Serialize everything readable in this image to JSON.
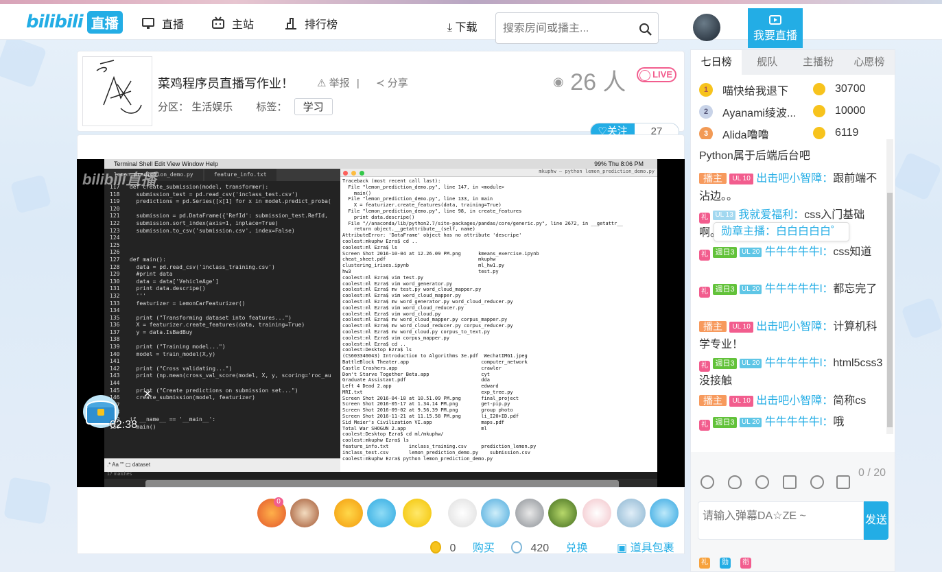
{
  "header": {
    "logo_text": "bilibili",
    "logo_live": "直播",
    "nav": [
      {
        "label": "直播",
        "icon": "monitor-icon"
      },
      {
        "label": "主站",
        "icon": "tv-icon"
      },
      {
        "label": "排行榜",
        "icon": "chart-icon"
      }
    ],
    "download": "下载",
    "search_placeholder": "搜索房间或播主...",
    "go_live": "我要直播"
  },
  "room": {
    "title": "菜鸡程序员直播写作业！",
    "report": "举报",
    "share": "分享",
    "area_label": "分区：",
    "area": "生活娱乐",
    "tag_label": "标签：",
    "tag": "学习",
    "viewers": "26 人",
    "live_badge": "LIVE",
    "follow_label": "关注",
    "follow_count": "27"
  },
  "player": {
    "timer": "02:38",
    "mac_menu": "Terminal   Shell   Edit   View   Window   Help",
    "mac_status": "99%   Thu 8:06 PM",
    "tab1": "lemon_prediction_demo.py",
    "tab2": "feature_info.txt",
    "find_text": "dataset",
    "matches": "17 matches",
    "term_title": "mkuphw — python lemon_prediction_demo.py",
    "code_lines": [
      "117   def create_submission(model, transformer):",
      "118     submission_test = pd.read_csv('inclass_test.csv')",
      "119     predictions = pd.Series([x[1] for x in model.predict_proba(",
      "120",
      "121     submission = pd.DataFrame({'RefId': submission_test.RefId,",
      "122     submission.sort_index(axis=1, inplace=True)",
      "123     submission.to_csv('submission.csv', index=False)",
      "124",
      "125",
      "126",
      "127   def main():",
      "128     data = pd.read_csv('inclass_training.csv')",
      "129     #print data",
      "130     data = data['VehicleAge']",
      "131     print data.descripe()",
      "132     '''",
      "133     featurizer = LemonCarFeaturizer()",
      "134",
      "135     print (\"Transforming dataset into features...\")",
      "136     X = featurizer.create_features(data, training=True)",
      "137     y = data.IsBadBuy",
      "138",
      "139     print (\"Training model...\")",
      "140     model = train_model(X,y)",
      "141",
      "142     print (\"Cross validating...\")",
      "143     print (np.mean(cross_val_score(model, X, y, scoring='roc_au",
      "144",
      "145     print (\"Create predictions on submission set...\")",
      "146     create_submission(model, featurizer)",
      "147",
      "148",
      "149   if __name__ == '__main__':",
      "150     main()"
    ],
    "term_lines": [
      "Traceback (most recent call last):",
      "  File \"lemon_prediction_demo.py\", line 147, in <module>",
      "    main()",
      "  File \"lemon_prediction_demo.py\", line 133, in main",
      "    X = featurizer.create_features(data, training=True)",
      "  File \"lemon_prediction_demo.py\", line 98, in create_features",
      "    print data.descripe()",
      "  File \"//anaconda/lib/python2.7/site-packages/pandas/core/generic.py\", line 2672, in __getattr__",
      "    return object.__getattribute__(self, name)",
      "AttributeError: 'DataFrame' object has no attribute 'descripe'",
      "coolest:mkuphw Ezra$ cd ..",
      "coolest:ml Ezra$ ls",
      "Screen Shot 2016-10-04 at 12.26.09 PM.png      kmeans_exercise.ipynb",
      "cheat_sheet.pdf                                mkuphw",
      "clustering_irises.ipynb                        ml_hw1.py",
      "hw3                                            test.py",
      "coolest:ml Ezra$ vim test.py",
      "coolest:ml Ezra$ vim word_generator.py",
      "coolest:ml Ezra$ mv test.py word_cloud_mapper.py",
      "coolest:ml Ezra$ vim word_cloud_mapper.py",
      "coolest:ml Ezra$ mv word_generator.py word_cloud_reducer.py",
      "coolest:ml Ezra$ vim word_cloud_reducer.py",
      "coolest:ml Ezra$ vim word_cloud.py",
      "coolest:ml Ezra$ mv word_cloud_mapper.py corpus_mapper.py",
      "coolest:ml Ezra$ mv word_cloud_reducer.py corpus_reducer.py",
      "coolest:ml Ezra$ mv word_cloud.py corpus_to_text.py",
      "coolest:ml Ezra$ vim corpus_mapper.py",
      "coolest:ml Ezra$ cd ..",
      "coolest:Desktop Ezra$ ls",
      "(CS603346043) Introduction to Algorithms 3e.pdf  WechatIMG1.jpeg",
      "BattleBlock Theater.app                         computer_network",
      "Castle Crashers.app                             crawler",
      "Don't Starve Together Beta.app                  cyt",
      "Graduate Assistant.pdf                          dda",
      "Left 4 Dead 2.app                               edward",
      "MRI.txt                                         exp_tree.py",
      "Screen Shot 2016-04-18 at 10.51.09 PM.png       final_project",
      "Screen Shot 2016-05-17 at 1.34.14 PM.png        get-pip.py",
      "Screen Shot 2016-09-02 at 9.56.39 PM.png        group photo",
      "Screen Shot 2016-11-21 at 11.15.58 PM.png       li_I20+ID.pdf",
      "Sid Meier's Civilization VI.app                 maps.pdf",
      "Total War SHOGUN 2.app                          ml",
      "coolest:Desktop Ezra$ cd ml/mkuphw/",
      "coolest:mkuphw Ezra$ ls",
      "feature_info.txt       inclass_training.csv     prediction_lemon.py",
      "inclass_test.csv       lemon_prediction_demo.py    submission.csv",
      "coolest:mkuphw Ezra$ python lemon_prediction_demo.py"
    ],
    "watermark": "bilibili直播"
  },
  "gifts": {
    "badge_count": "0",
    "gold_count": "0",
    "buy_label": "购买",
    "silver_count": "420",
    "exchange_label": "兑换",
    "bag_label": "道具包裹"
  },
  "sidebar": {
    "tabs": [
      "七日榜",
      "舰队",
      "主播粉",
      "心愿榜"
    ],
    "ranking": [
      {
        "rank": "1",
        "name": "喵快给我退下",
        "score": "30700"
      },
      {
        "rank": "2",
        "name": "Ayanami绫波...",
        "score": "10000"
      },
      {
        "rank": "3",
        "name": "Alida噜噜",
        "score": "6119"
      }
    ],
    "chat": [
      {
        "type": "cont",
        "text": "Python属于后端后台吧"
      },
      {
        "type": "host",
        "host": "播主",
        "lvl": "UL 10",
        "user": "出击吧小智障：",
        "text": "跟前端不沾边。。"
      },
      {
        "type": "user",
        "lvl": "UL 13",
        "user": "我就爱福利：",
        "text": "css入门基础啊。"
      },
      {
        "type": "fan",
        "medal": "週日3",
        "lvl": "UL 20",
        "user": "牛牛牛牛牛l：",
        "text": "css知道"
      },
      {
        "type": "fan",
        "medal": "週日3",
        "lvl": "UL 20",
        "user": "牛牛牛牛牛l：",
        "text": "都忘完了"
      },
      {
        "type": "host",
        "host": "播主",
        "lvl": "UL 10",
        "user": "出击吧小智障：",
        "text": "计算机科学专业！"
      },
      {
        "type": "fan",
        "medal": "週日3",
        "lvl": "UL 20",
        "user": "牛牛牛牛牛l：",
        "text": "html5css3没接触"
      },
      {
        "type": "host",
        "host": "播主",
        "lvl": "UL 10",
        "user": "出击吧小智障：",
        "text": "简称cs"
      },
      {
        "type": "fan",
        "medal": "週日3",
        "lvl": "UL 20",
        "user": "牛牛牛牛牛l：",
        "text": "哦"
      }
    ],
    "tooltip": "勋章主播：白白白白白゜",
    "counter": "0 / 20",
    "input_placeholder": "请输入弹幕DA☆ZE ~",
    "send": "发送"
  },
  "colors": {
    "accent": "#23ade5",
    "pink": "#f25d8e",
    "host": "#f79a5d"
  }
}
